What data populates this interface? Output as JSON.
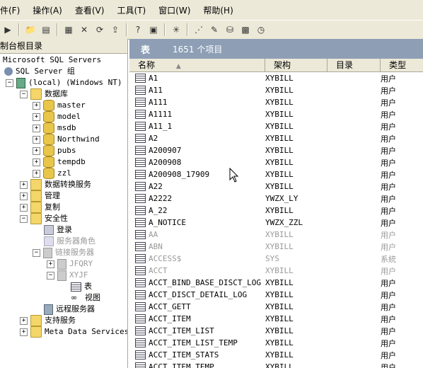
{
  "menu": [
    "件(F)",
    "操作(A)",
    "查看(V)",
    "工具(T)",
    "窗口(W)",
    "帮助(H)"
  ],
  "tree": {
    "header": "制台根目录",
    "nodes": [
      {
        "label": "Microsoft SQL Servers",
        "level": 0
      },
      {
        "label": "SQL Server 组",
        "level": 1
      },
      {
        "label": "(local) (Windows NT)",
        "level": 2
      },
      {
        "label": "数据库",
        "level": 3
      },
      {
        "label": "master",
        "level": 4
      },
      {
        "label": "model",
        "level": 4
      },
      {
        "label": "msdb",
        "level": 4
      },
      {
        "label": "Northwind",
        "level": 4
      },
      {
        "label": "pubs",
        "level": 4
      },
      {
        "label": "tempdb",
        "level": 4
      },
      {
        "label": "zzl",
        "level": 4
      },
      {
        "label": "数据转换服务",
        "level": 3
      },
      {
        "label": "管理",
        "level": 3
      },
      {
        "label": "复制",
        "level": 3
      },
      {
        "label": "安全性",
        "level": 3
      },
      {
        "label": "登录",
        "level": 4
      },
      {
        "label": "服务器角色",
        "level": 4
      },
      {
        "label": "链接服务器",
        "level": 4
      },
      {
        "label": "JFQRY",
        "level": 5
      },
      {
        "label": "XYJF",
        "level": 5
      },
      {
        "label": "表",
        "level": 6
      },
      {
        "label": "视图",
        "level": 6
      },
      {
        "label": "远程服务器",
        "level": 4
      },
      {
        "label": "支持服务",
        "level": 3
      },
      {
        "label": "Meta Data Services",
        "level": 3
      }
    ]
  },
  "panel": {
    "title": "表",
    "count": "1651 个项目",
    "columns": [
      "名称",
      "架构",
      "目录",
      "类型"
    ],
    "rows": [
      {
        "name": "A1",
        "schema": "XYBILL",
        "type": "用户"
      },
      {
        "name": "A11",
        "schema": "XYBILL",
        "type": "用户"
      },
      {
        "name": "A111",
        "schema": "XYBILL",
        "type": "用户"
      },
      {
        "name": "A1111",
        "schema": "XYBILL",
        "type": "用户"
      },
      {
        "name": "A11_1",
        "schema": "XYBILL",
        "type": "用户"
      },
      {
        "name": "A2",
        "schema": "XYBILL",
        "type": "用户"
      },
      {
        "name": "A200907",
        "schema": "XYBILL",
        "type": "用户"
      },
      {
        "name": "A200908",
        "schema": "XYBILL",
        "type": "用户"
      },
      {
        "name": "A200908_17909",
        "schema": "XYBILL",
        "type": "用户"
      },
      {
        "name": "A22",
        "schema": "XYBILL",
        "type": "用户"
      },
      {
        "name": "A2222",
        "schema": "YWZX_LY",
        "type": "用户"
      },
      {
        "name": "A_22",
        "schema": "XYBILL",
        "type": "用户"
      },
      {
        "name": "A_NOTICE",
        "schema": "YWZX_ZZL",
        "type": "用户"
      },
      {
        "name": "AA",
        "schema": "XYBILL",
        "type": "用户"
      },
      {
        "name": "ABN",
        "schema": "XYBILL",
        "type": "用户"
      },
      {
        "name": "ACCESS$",
        "schema": "SYS",
        "type": "系統"
      },
      {
        "name": "ACCT",
        "schema": "XYBILL",
        "type": "用户"
      },
      {
        "name": "ACCT_BIND_BASE_DISCT_LOG",
        "schema": "XYBILL",
        "type": "用户"
      },
      {
        "name": "ACCT_DISCT_DETAIL_LOG",
        "schema": "XYBILL",
        "type": "用户"
      },
      {
        "name": "ACCT_GETT",
        "schema": "XYBILL",
        "type": "用户"
      },
      {
        "name": "ACCT_ITEM",
        "schema": "XYBILL",
        "type": "用户"
      },
      {
        "name": "ACCT_ITEM_LIST",
        "schema": "XYBILL",
        "type": "用户"
      },
      {
        "name": "ACCT_ITEM_LIST_TEMP",
        "schema": "XYBILL",
        "type": "用户"
      },
      {
        "name": "ACCT_ITEM_STATS",
        "schema": "XYBILL",
        "type": "用户"
      },
      {
        "name": "ACCT_ITEM_TEMP",
        "schema": "XYBILL",
        "type": "用户"
      }
    ]
  }
}
